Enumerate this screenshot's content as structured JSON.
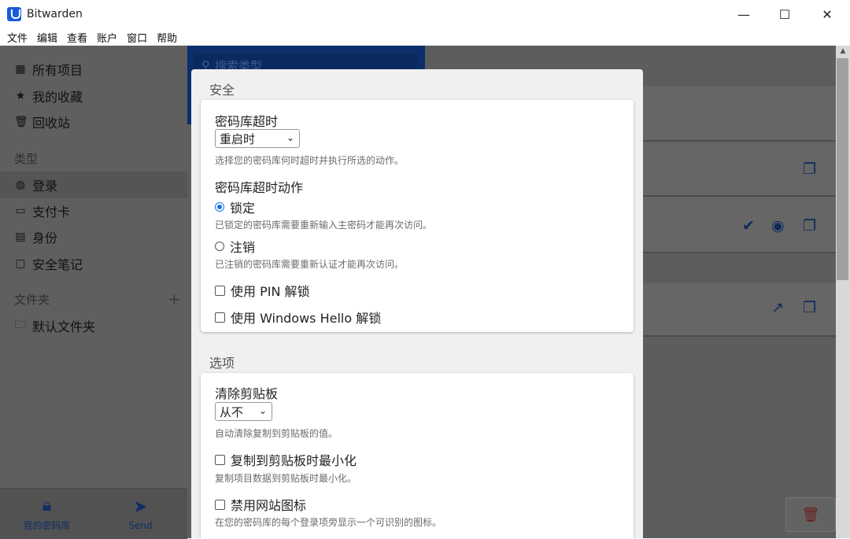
{
  "window": {
    "title": "Bitwarden",
    "minimize": "—",
    "maximize": "☐",
    "close": "✕"
  },
  "menu": [
    "文件",
    "编辑",
    "查看",
    "账户",
    "窗口",
    "帮助"
  ],
  "sidebar": {
    "items": [
      {
        "label": "所有项目",
        "icon": "grid-icon"
      },
      {
        "label": "我的收藏",
        "icon": "star-icon"
      },
      {
        "label": "回收站",
        "icon": "trash-icon"
      }
    ],
    "types_header": "类型",
    "types": [
      {
        "label": "登录",
        "icon": "globe-icon"
      },
      {
        "label": "支付卡",
        "icon": "credit-card-icon"
      },
      {
        "label": "身份",
        "icon": "id-card-icon"
      },
      {
        "label": "安全笔记",
        "icon": "note-icon"
      }
    ],
    "folders_header": "文件夹",
    "add_folder": "+",
    "folders": [
      {
        "label": "默认文件夹",
        "icon": "folder-icon"
      }
    ],
    "tabs": [
      {
        "label": "我的密码库",
        "icon": "lock-icon"
      },
      {
        "label": "Send",
        "icon": "send-icon"
      }
    ]
  },
  "search": {
    "placeholder": "搜索类型"
  },
  "settings": {
    "security_title": "安全",
    "vault_timeout": {
      "label": "密码库超时",
      "selected": "重启时",
      "hint": "选择您的密码库何时超时并执行所选的动作。"
    },
    "timeout_action": {
      "label": "密码库超时动作",
      "lock_label": "锁定",
      "lock_hint": "已锁定的密码库需要重新输入主密码才能再次访问。",
      "logout_label": "注销",
      "logout_hint": "已注销的密码库需要重新认证才能再次访问。",
      "selected": "lock"
    },
    "pin_unlock": {
      "label": "使用 PIN 解锁",
      "checked": false
    },
    "windows_hello": {
      "label": "使用 Windows Hello 解锁",
      "checked": false
    },
    "options_title": "选项",
    "clear_clipboard": {
      "label": "清除剪贴板",
      "selected": "从不",
      "hint": "自动清除复制到剪贴板的值。"
    },
    "minimize_on_copy": {
      "label": "复制到剪贴板时最小化",
      "hint": "复制项目数据到剪贴板时最小化。",
      "checked": false
    },
    "disable_favicon": {
      "label": "禁用网站图标",
      "hint": "在您的密码库的每个登录项旁显示一个可识别的图标。",
      "checked": false
    }
  },
  "colors": {
    "brand": "#175ddc",
    "overlay_navy": "#0c2f6b",
    "radio_accent": "#1a73e8"
  }
}
